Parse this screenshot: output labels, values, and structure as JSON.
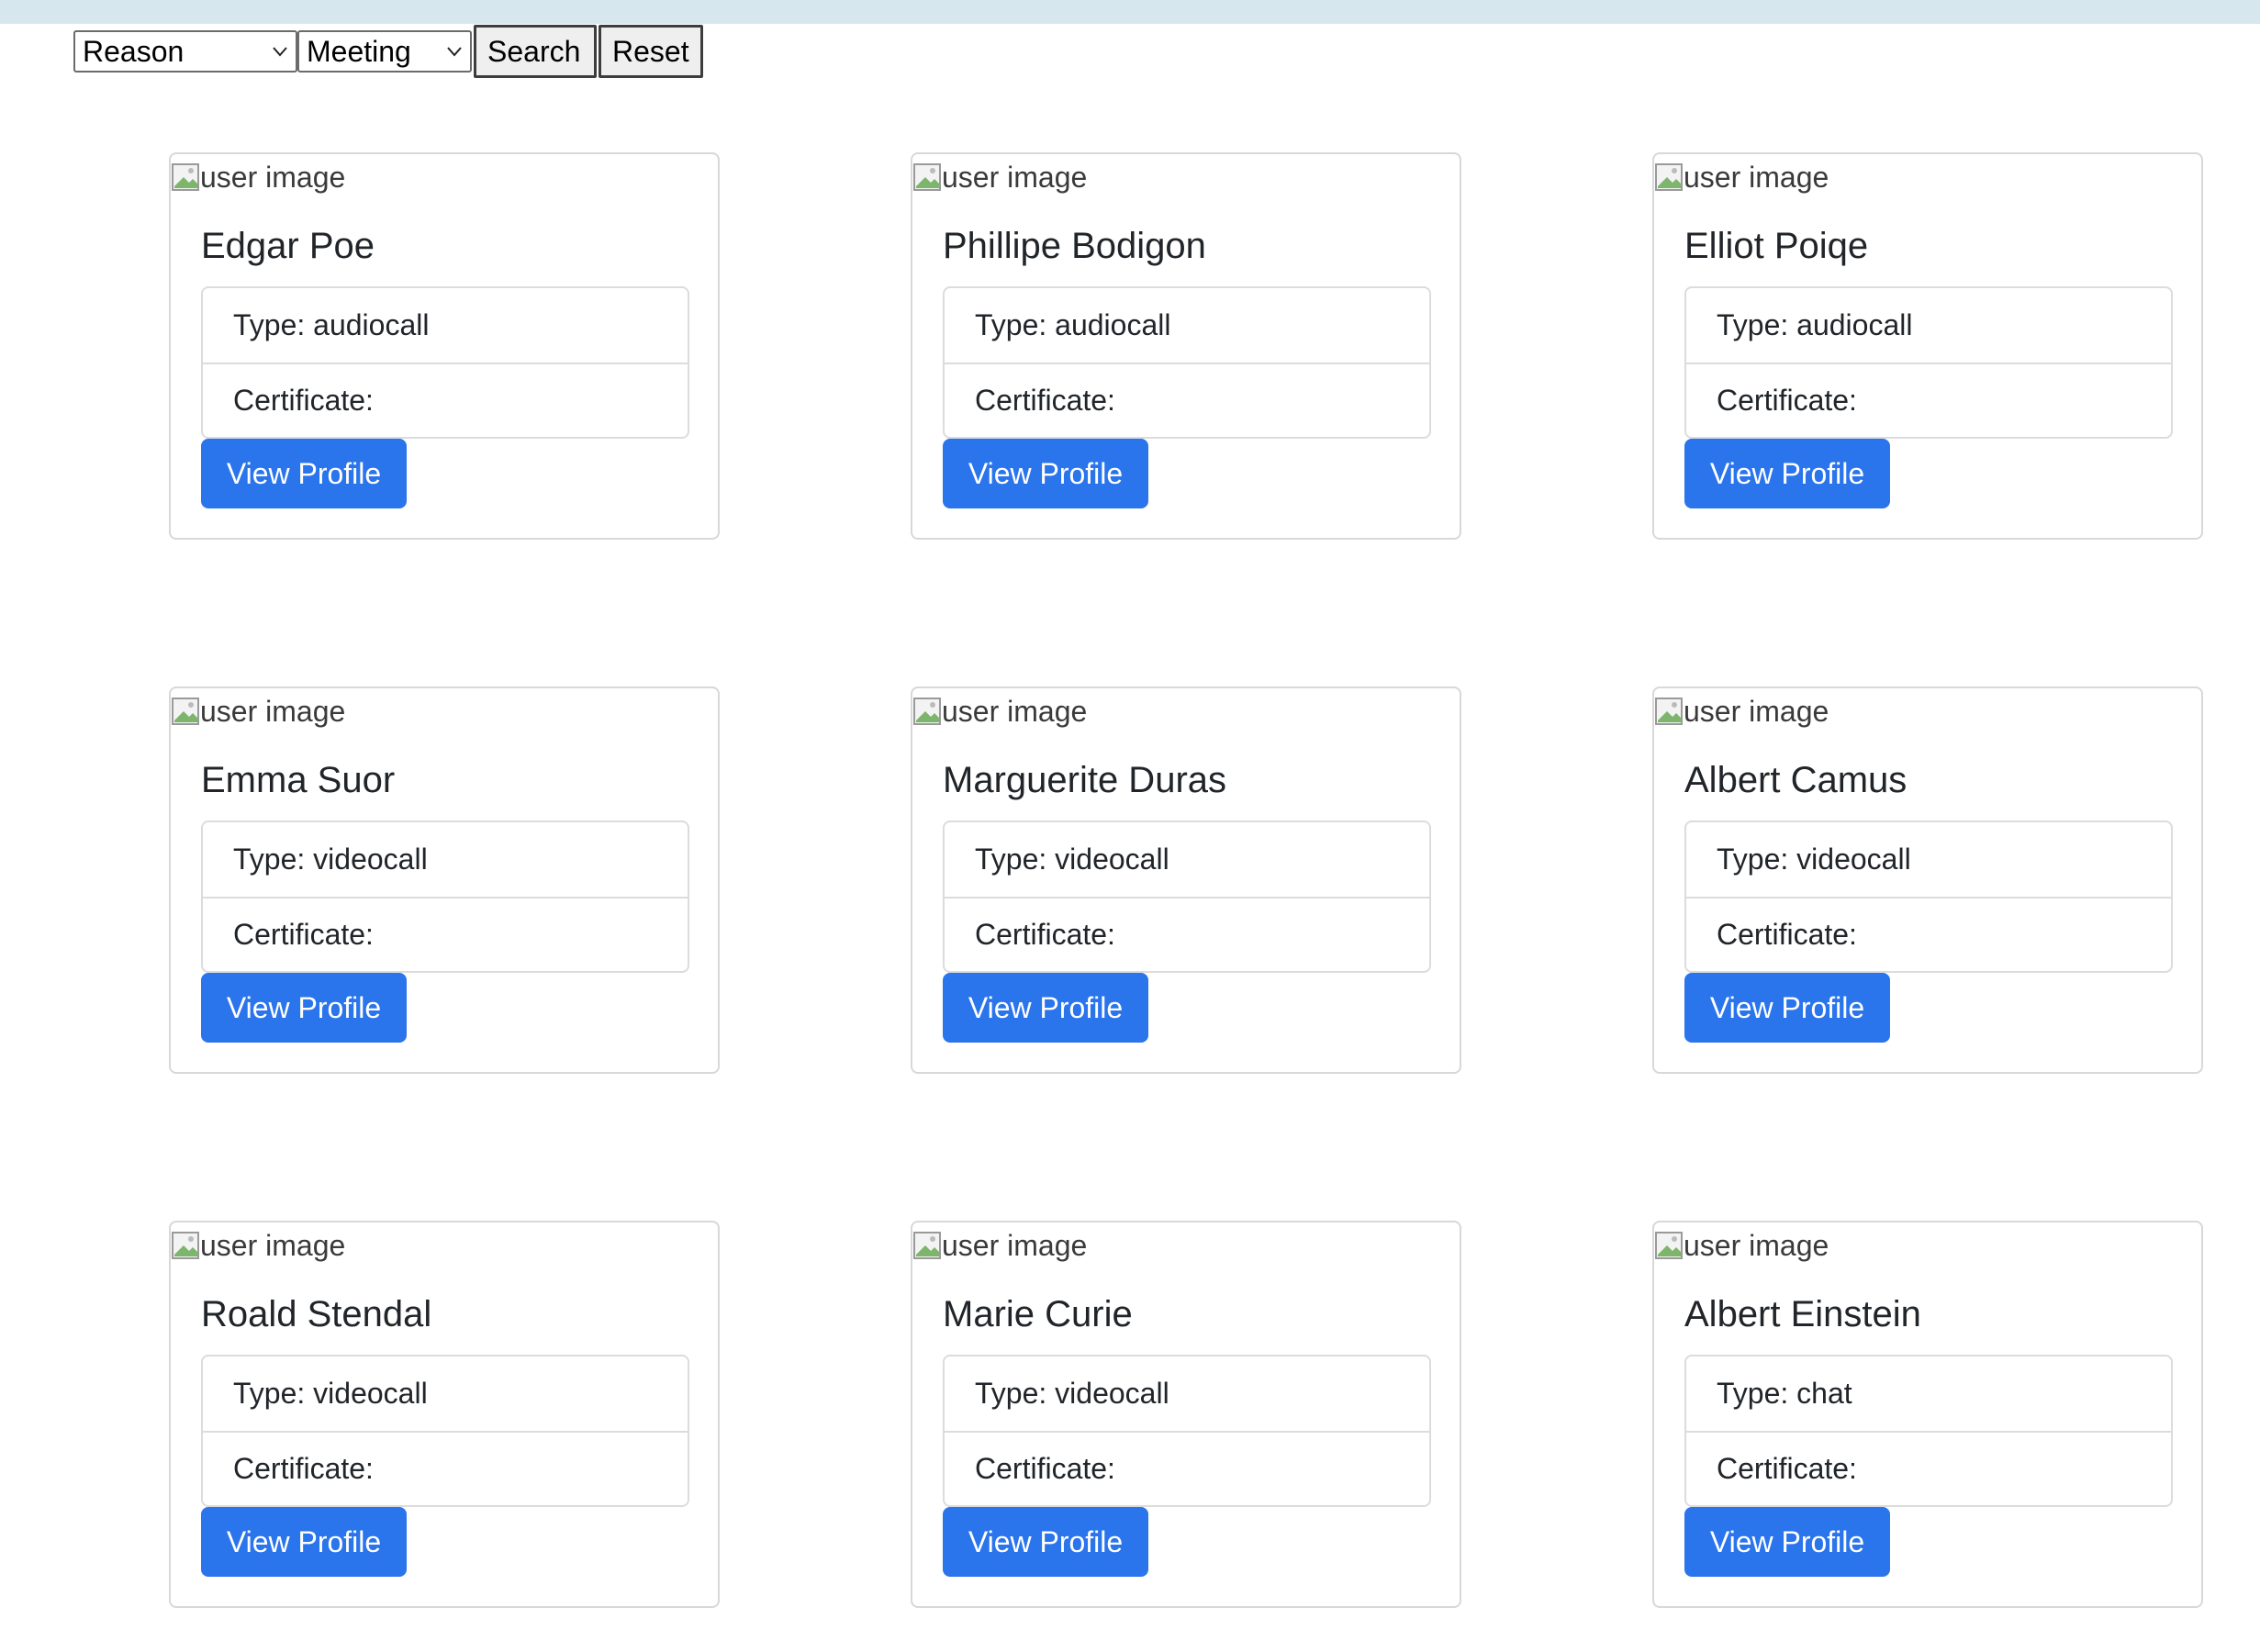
{
  "filters": {
    "reason_select": "Reason",
    "meeting_select": "Meeting",
    "search_label": "Search",
    "reset_label": "Reset"
  },
  "cards": [
    {
      "image_alt": "user image",
      "name": "Edgar Poe",
      "type": "Type: audiocall",
      "certificate": "Certificate:",
      "button": "View Profile"
    },
    {
      "image_alt": "user image",
      "name": "Phillipe Bodigon",
      "type": "Type: audiocall",
      "certificate": "Certificate:",
      "button": "View Profile"
    },
    {
      "image_alt": "user image",
      "name": "Elliot Poiqe",
      "type": "Type: audiocall",
      "certificate": "Certificate:",
      "button": "View Profile"
    },
    {
      "image_alt": "user image",
      "name": "Emma Suor",
      "type": "Type: videocall",
      "certificate": "Certificate:",
      "button": "View Profile"
    },
    {
      "image_alt": "user image",
      "name": "Marguerite Duras",
      "type": "Type: videocall",
      "certificate": "Certificate:",
      "button": "View Profile"
    },
    {
      "image_alt": "user image",
      "name": "Albert Camus",
      "type": "Type: videocall",
      "certificate": "Certificate:",
      "button": "View Profile"
    },
    {
      "image_alt": "user image",
      "name": "Roald Stendal",
      "type": "Type: videocall",
      "certificate": "Certificate:",
      "button": "View Profile"
    },
    {
      "image_alt": "user image",
      "name": "Marie Curie",
      "type": "Type: videocall",
      "certificate": "Certificate:",
      "button": "View Profile"
    },
    {
      "image_alt": "user image",
      "name": "Albert Einstein",
      "type": "Type: chat",
      "certificate": "Certificate:",
      "button": "View Profile"
    }
  ],
  "colors": {
    "top_bar": "#d6e8ee",
    "primary_button": "#2a74ec"
  }
}
